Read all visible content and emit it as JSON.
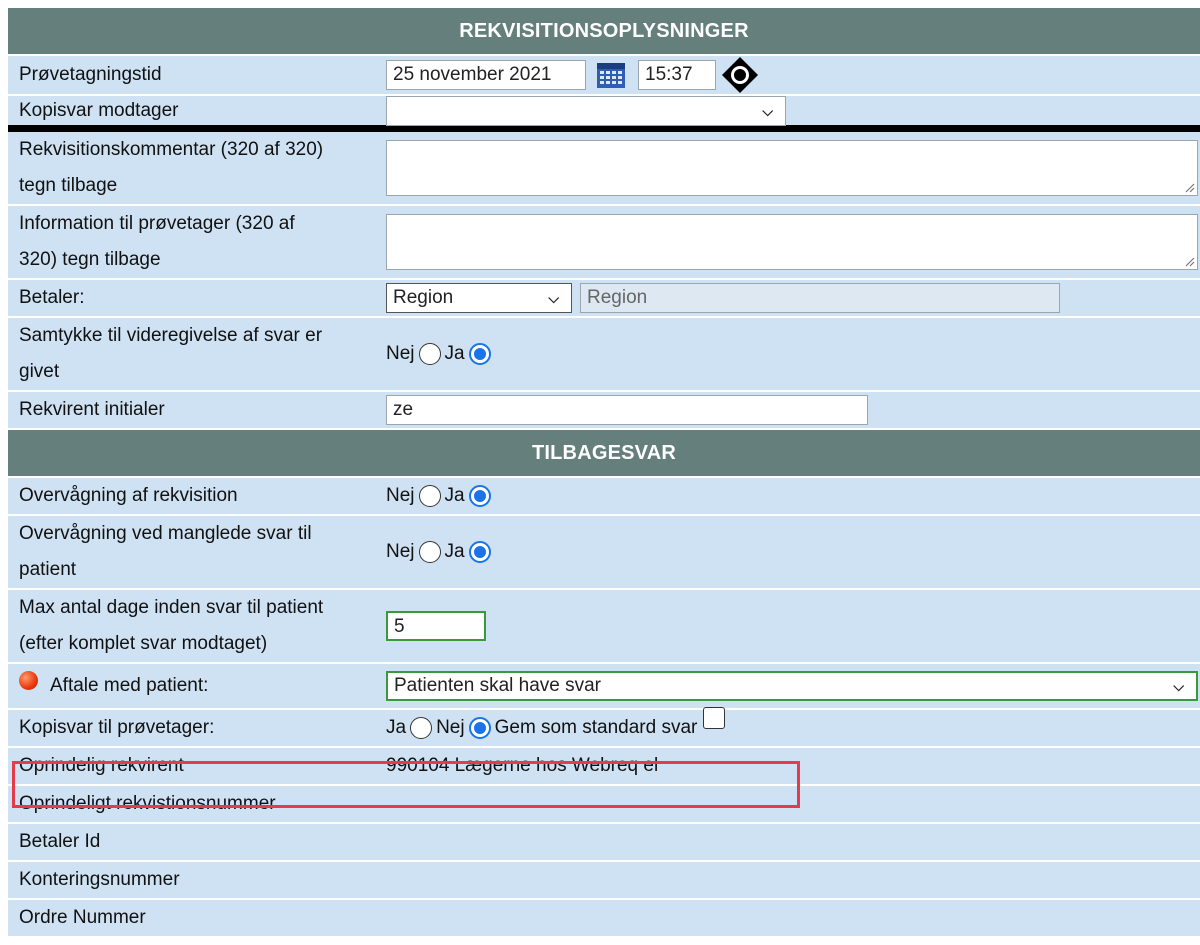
{
  "sections": {
    "requisition_title": "REKVISITIONSOPLYSNINGER",
    "reply_title": "TILBAGESVAR"
  },
  "fields": {
    "sample_time": {
      "label": "Prøvetagningstid",
      "date": "25 november 2021",
      "time": "15:37"
    },
    "copy_recipient": {
      "label": "Kopisvar modtager",
      "value": ""
    },
    "req_comment": {
      "label_line1": "Rekvisitionskommentar (320 af 320)",
      "label_line2": "tegn tilbage",
      "value": ""
    },
    "sampler_info": {
      "label_line1": "Information til prøvetager (320 af",
      "label_line2": "320) tegn tilbage",
      "value": ""
    },
    "payer": {
      "label": "Betaler:",
      "selected": "Region",
      "readonly": "Region"
    },
    "consent": {
      "label_line1": "Samtykke til videregivelse af svar er",
      "label_line2": "givet",
      "no": "Nej",
      "yes": "Ja",
      "selected": "Ja"
    },
    "initials": {
      "label": "Rekvirent initialer",
      "value": "ze"
    }
  },
  "reply": {
    "monitoring": {
      "label": "Overvågning af rekvisition",
      "no": "Nej",
      "yes": "Ja",
      "selected": "Ja"
    },
    "missing_monitoring": {
      "label_line1": "Overvågning ved manglede svar til",
      "label_line2": "patient",
      "no": "Nej",
      "yes": "Ja",
      "selected": "Ja"
    },
    "max_days": {
      "label_line1": "Max antal dage inden svar til patient",
      "label_line2": "(efter komplet svar modtaget)",
      "value": "5"
    },
    "agreement": {
      "label": "Aftale med patient:",
      "selected": "Patienten skal have svar"
    },
    "copy_sampler": {
      "label": "Kopisvar til prøvetager:",
      "yes": "Ja",
      "no": "Nej",
      "selected": "Nej",
      "save_default": "Gem som standard svar"
    },
    "original_requester": {
      "label": "Oprindelig rekvirent",
      "value": "990104 Lægerne hos Webreq el"
    },
    "original_number": {
      "label": "Oprindeligt rekvistionsnummer"
    },
    "payer_id": {
      "label": "Betaler Id"
    },
    "account_number": {
      "label": "Konteringsnummer"
    },
    "order_number": {
      "label": "Ordre Nummer"
    }
  },
  "colors": {
    "header": "#647f7c",
    "row": "#cfe2f3",
    "highlight": "#e33c4a",
    "radio": "#1a73e8"
  },
  "icons": [
    "calendar-icon",
    "time-spinner-icon",
    "chevron-down-icon",
    "required-dot-icon"
  ]
}
